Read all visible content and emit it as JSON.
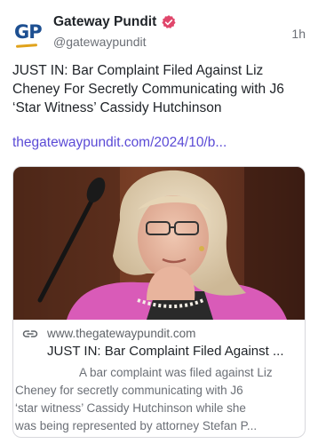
{
  "account": {
    "name": "Gateway Pundit",
    "handle": "@gatewaypundit",
    "avatar_text": "GP",
    "time": "1h"
  },
  "post": {
    "text": "JUST IN: Bar Complaint Filed Against Liz Cheney For Secretly Communicating with J6 ‘Star Witness’ Cassidy Hutchinson",
    "link": "thegatewaypundit.com/2024/10/b..."
  },
  "card": {
    "domain": "www.thegatewaypundit.com",
    "title": "JUST IN: Bar Complaint Filed Against ...",
    "description_lines": [
      "A bar complaint was filed against Liz",
      "Cheney for secretly communicating with J6",
      "‘star witness’ Cassidy Hutchinson while she",
      "was being represented by attorney Stefan P..."
    ]
  },
  "icons": {
    "verified": "verified-badge-icon",
    "link": "link-icon"
  },
  "colors": {
    "link": "#5b4bd6",
    "verified": "#e0466b",
    "brand_blue": "#1d4f91",
    "brand_gold": "#e0a21b"
  }
}
